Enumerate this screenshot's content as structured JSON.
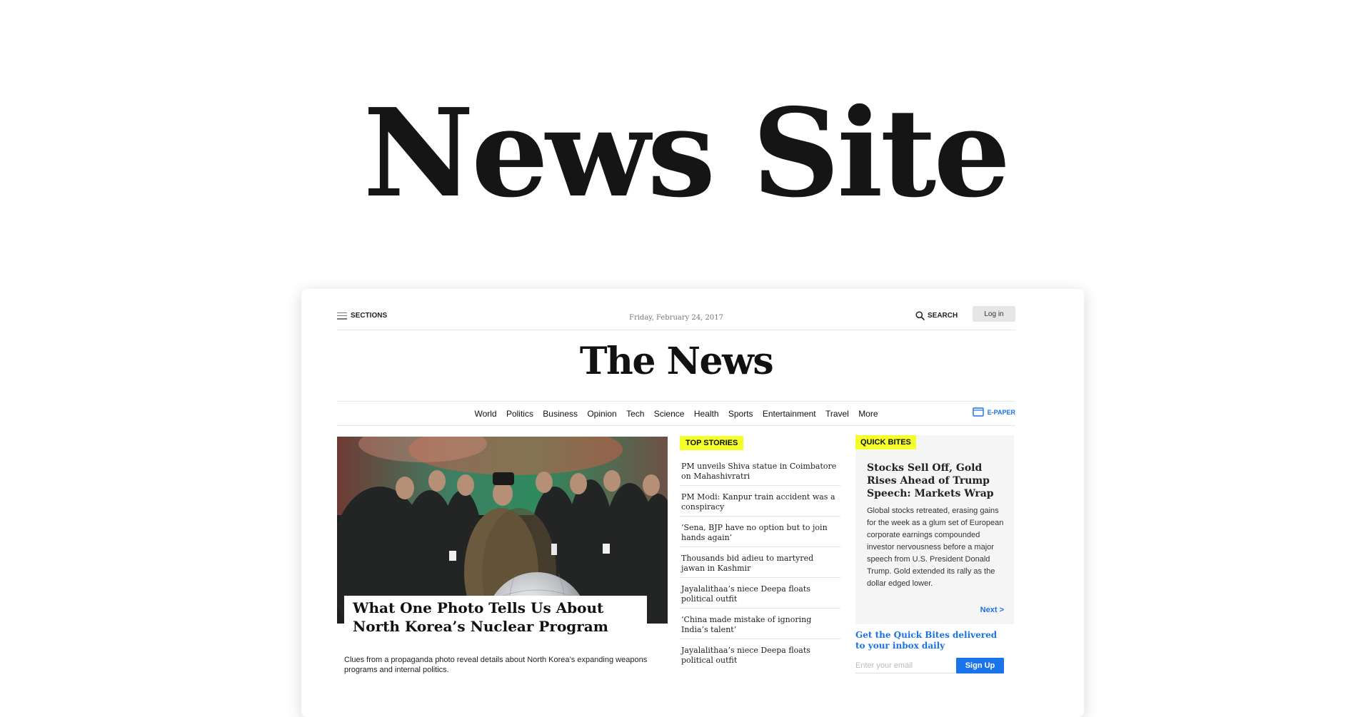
{
  "hero": {
    "title": "News Site"
  },
  "topbar": {
    "sections_label": "SECTIONS",
    "date": "Friday, February 24, 2017",
    "search_label": "SEARCH",
    "login_label": "Log in"
  },
  "masthead": {
    "title": "The News"
  },
  "nav": {
    "items": [
      "World",
      "Politics",
      "Business",
      "Opinion",
      "Tech",
      "Science",
      "Health",
      "Sports",
      "Entertainment",
      "Travel",
      "More"
    ],
    "epaper_label": "E-PAPER"
  },
  "lead": {
    "title": "What One Photo Tells Us About North Korea’s Nuclear Program",
    "summary": "Clues from a propaganda photo reveal details about North Korea’s expanding weapons programs and internal politics."
  },
  "top_stories": {
    "label": "TOP STORIES",
    "items": [
      "PM unveils Shiva statue in Coimbatore on Mahashivratri",
      "PM Modi: Kanpur train accident was a conspiracy",
      "‘Sena, BJP have no option but to join hands again’",
      "Thousands bid adieu to martyred jawan in Kashmir",
      "Jayalalithaa’s niece Deepa floats political outfit",
      "‘China made mistake of ignoring India’s talent’",
      "Jayalalithaa’s niece Deepa floats political outfit"
    ]
  },
  "quick_bites": {
    "label": "QUICK BITES",
    "title": "Stocks Sell Off, Gold Rises Ahead of Trump Speech: Markets Wrap",
    "body": "Global stocks retreated, erasing gains for the week as a glum set of European corporate earnings compounded investor nervousness before a major speech from U.S. President Donald Trump. Gold extended its rally as the dollar edged lower.",
    "next_label": "Next >"
  },
  "newsletter": {
    "title": "Get the Quick Bites delivered to your inbox daily",
    "placeholder": "Enter your email",
    "button_label": "Sign Up"
  },
  "colors": {
    "accent_blue": "#1a73e8",
    "badge_yellow": "#f4ff2a",
    "login_gray": "#e6e6e6",
    "panel_gray": "#f5f5f5"
  }
}
